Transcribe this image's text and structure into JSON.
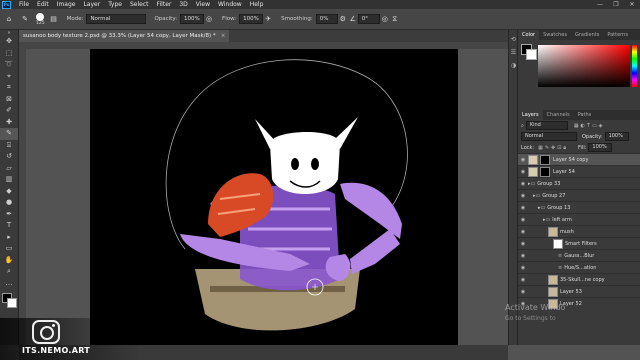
{
  "app": {
    "logo_text": "Ps"
  },
  "menu": [
    "File",
    "Edit",
    "Image",
    "Layer",
    "Type",
    "Select",
    "Filter",
    "3D",
    "View",
    "Window",
    "Help"
  ],
  "window_controls": [
    "—",
    "❐",
    "✕"
  ],
  "options": {
    "brush_size": "125",
    "mode_label": "Mode:",
    "mode_value": "Normal",
    "opacity_label": "Opacity:",
    "opacity_value": "100%",
    "flow_label": "Flow:",
    "flow_value": "100%",
    "smoothing_label": "Smoothing:",
    "smoothing_value": "0%",
    "angle_value": "0°"
  },
  "document": {
    "tab_title": "susanoo body texture 2.psd @ 33.3% (Layer 54 copy, Layer Mask/8) *",
    "close": "×"
  },
  "tools": [
    "move-icon",
    "marquee-icon",
    "lasso-icon",
    "quick-select-icon",
    "crop-icon",
    "frame-icon",
    "eyedropper-icon",
    "healing-icon",
    "brush-icon",
    "stamp-icon",
    "history-brush-icon",
    "eraser-icon",
    "gradient-icon",
    "blur-icon",
    "dodge-icon",
    "pen-icon",
    "type-icon",
    "path-select-icon",
    "shape-icon",
    "hand-icon",
    "zoom-icon",
    "more-icon"
  ],
  "panels": {
    "color_tabs": [
      "Color",
      "Swatches",
      "Gradients",
      "Patterns"
    ],
    "layer_tabs": [
      "Layers",
      "Channels",
      "Paths"
    ],
    "filter_kind": "Kind",
    "blend_mode": "Normal",
    "opacity_label": "Opacity:",
    "opacity_value": "100%",
    "lock_label": "Lock:",
    "fill_label": "Fill:",
    "fill_value": "100%",
    "layers": [
      {
        "name": "Layer 54 copy",
        "type": "layer-mask",
        "indent": 0,
        "selected": true,
        "visible": true
      },
      {
        "name": "Layer 54",
        "type": "layer-mask",
        "indent": 0,
        "selected": false,
        "visible": true
      },
      {
        "name": "Group 33",
        "type": "group",
        "indent": 0,
        "selected": false,
        "visible": true
      },
      {
        "name": "Group 27",
        "type": "group",
        "indent": 1,
        "selected": false,
        "visible": true
      },
      {
        "name": "Group 13",
        "type": "group",
        "indent": 2,
        "selected": false,
        "visible": true
      },
      {
        "name": "left arm",
        "type": "group",
        "indent": 3,
        "selected": false,
        "visible": true
      },
      {
        "name": "mush",
        "type": "layer",
        "indent": 4,
        "selected": false,
        "visible": true
      },
      {
        "name": "Smart Filters",
        "type": "filter",
        "indent": 5,
        "selected": false,
        "visible": true
      },
      {
        "name": "Gauss...Blur",
        "type": "filter-item",
        "indent": 6,
        "selected": false,
        "visible": true
      },
      {
        "name": "Hue/S...ation",
        "type": "filter-item",
        "indent": 6,
        "selected": false,
        "visible": true
      },
      {
        "name": "35-Skull...ne copy",
        "type": "layer",
        "indent": 4,
        "selected": false,
        "visible": true
      },
      {
        "name": "Layer 53",
        "type": "layer",
        "indent": 4,
        "selected": false,
        "visible": true
      },
      {
        "name": "Layer 52",
        "type": "layer",
        "indent": 4,
        "selected": false,
        "visible": true
      }
    ]
  },
  "watermark": {
    "line1": "Activate Windo",
    "line2": "Go to Settings to"
  },
  "brand": {
    "handle": "ITS.NEMO.ART"
  }
}
